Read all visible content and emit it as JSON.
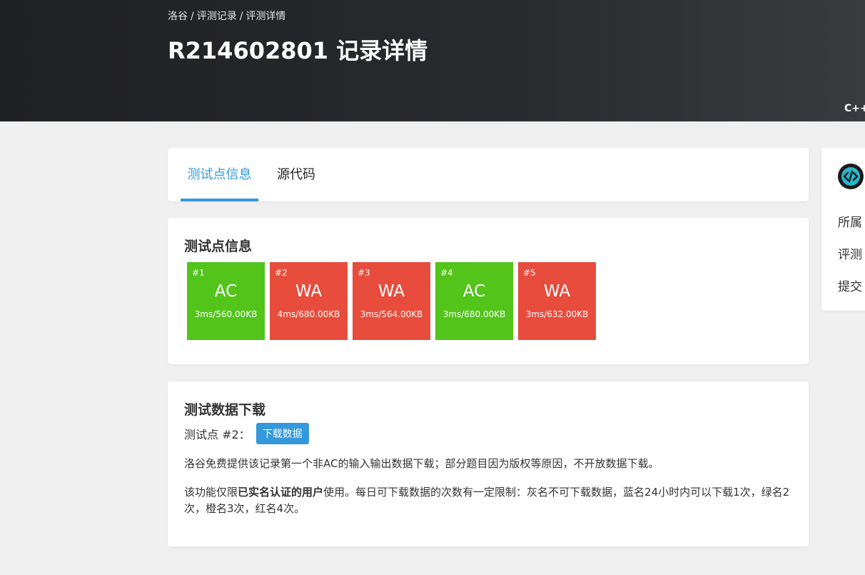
{
  "header": {
    "breadcrumb": [
      "洛谷",
      "评测记录",
      "评测详情"
    ],
    "breadcrumb_separator": "/",
    "title": "R214602801 记录详情",
    "language": "C++"
  },
  "tabs": [
    {
      "label": "测试点信息",
      "active": true
    },
    {
      "label": "源代码",
      "active": false
    }
  ],
  "tests": {
    "title": "测试点信息",
    "items": [
      {
        "num": "#1",
        "status": "AC",
        "stat": "3ms/560.00KB"
      },
      {
        "num": "#2",
        "status": "WA",
        "stat": "4ms/680.00KB"
      },
      {
        "num": "#3",
        "status": "WA",
        "stat": "3ms/564.00KB"
      },
      {
        "num": "#4",
        "status": "AC",
        "stat": "3ms/680.00KB"
      },
      {
        "num": "#5",
        "status": "WA",
        "stat": "3ms/632.00KB"
      }
    ]
  },
  "download": {
    "title": "测试数据下载",
    "label": "测试点 #2：",
    "button": "下载数据",
    "text1": "洛谷免费提供该记录第一个非AC的输入输出数据下载；部分题目因为版权等原因，不开放数据下载。",
    "text2_prefix": "该功能仅限",
    "text2_bold": "已实名认证的用户",
    "text2_suffix": "使用。每日可下载数据的次数有一定限制：灰名不可下载数据，蓝名24小时内可以下载1次，绿名2次，橙名3次，红名4次。"
  },
  "side": {
    "icon": "code-icon",
    "labels": [
      "所属",
      "评测",
      "提交"
    ]
  },
  "colors": {
    "accent": "#3498db",
    "ac": "#52c41a",
    "wa": "#e74c3c"
  }
}
